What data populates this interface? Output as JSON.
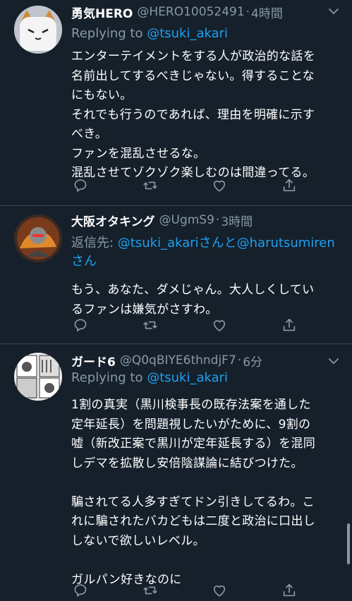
{
  "tweets": [
    {
      "name": "勇気HERO",
      "handle": "@HERO10052491",
      "time": "4時間",
      "reply_prefix": "Replying to ",
      "reply_to": "@tsuki_akari",
      "text": "エンターテイメントをする人が政治的な話を\n名前出してするべきじゃない。得することな\nにもない。\nそれでも行うのであれば、理由を明確に示す\nべき。\nファンを混乱させるな。\n混乱させてゾクゾク楽しむのは間違ってる。"
    },
    {
      "name": "大阪オタキング",
      "handle": "@UgmS9",
      "time": "3時間",
      "reply_prefix": "返信先: ",
      "reply_to": "@tsuki_akari",
      "reply_join": "さんと",
      "reply_to2": "@harutsumiren",
      "reply_suffix": "さん",
      "text": "もう、あなた、ダメじゃん。大人しくしてい\nるファンは嫌気がさすわ。"
    },
    {
      "name": "ガード6",
      "handle": "@Q0qBIYE6thndjF7",
      "time": "6分",
      "reply_prefix": "Replying to ",
      "reply_to": "@tsuki_akari",
      "text": "1割の真実（黒川検事長の既存法案を通した\n定年延長）を問題視したいがために、9割の\n嘘（新改正案で黒川が定年延長する）を混同\nしデマを拡散し安倍陰謀論に結びつけた。\n\n騙されてる人多すぎてドン引きしてるわ。こ\nれに騙されたバカどもは二度と政治に口出し\nしないで欲しいレベル。\n\nガルパン好きなのに"
    }
  ],
  "colors": {
    "background": "#15202b",
    "text": "#ffffff",
    "secondary": "#8899a6",
    "mention": "#1da1f2",
    "divider": "#38444d"
  },
  "icons": [
    "reply-icon",
    "retweet-icon",
    "like-icon",
    "share-icon",
    "chevron-down-icon"
  ]
}
